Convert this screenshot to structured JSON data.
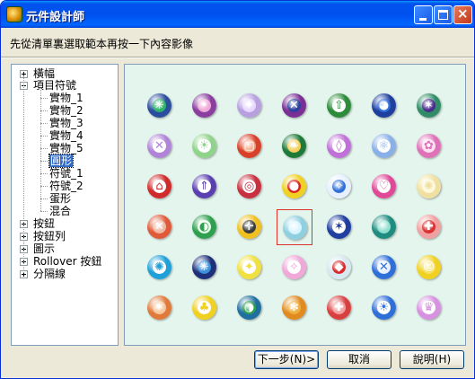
{
  "window": {
    "title": "元件設計師",
    "instruction": "先從清單裏選取範本再按一下內容影像"
  },
  "tree": {
    "items": [
      {
        "label": "橫幅",
        "expander": "plus"
      },
      {
        "label": "項目符號",
        "expander": "minus"
      },
      {
        "label": "實物_1"
      },
      {
        "label": "實物_2"
      },
      {
        "label": "實物_3"
      },
      {
        "label": "實物_4"
      },
      {
        "label": "實物_5"
      },
      {
        "label": "圓形",
        "selected": true
      },
      {
        "label": "符號_1"
      },
      {
        "label": "符號_2"
      },
      {
        "label": "蛋形"
      },
      {
        "label": "混合"
      },
      {
        "label": "按鈕",
        "expander": "plus"
      },
      {
        "label": "按鈕列",
        "expander": "plus"
      },
      {
        "label": "圖示",
        "expander": "plus"
      },
      {
        "label": "Rollover 按鈕",
        "expander": "plus"
      },
      {
        "label": "分隔線",
        "expander": "plus"
      }
    ]
  },
  "gallery": {
    "selected_index": 24,
    "items": [
      {
        "icon": "green-asterisk-bullet-icon",
        "ring": "#2b4d9e",
        "core": "#2fb36b",
        "mark": "✳"
      },
      {
        "icon": "pink-dot-bullet-icon",
        "ring": "#8a3fa0",
        "core": "#f0a8d8",
        "mark": "•"
      },
      {
        "icon": "lavender-star-bullet-icon",
        "ring": "#b8a0e0",
        "core": "#e8d8ff",
        "mark": "✦"
      },
      {
        "icon": "purple-x-bullet-icon",
        "ring": "#7a2f95",
        "core": "#2c3f9e",
        "mark": "✕"
      },
      {
        "icon": "green-arrow-up-bullet-icon",
        "ring": "#2c8c3a",
        "core": "#ffffff",
        "mark": "⇧"
      },
      {
        "icon": "blue-globe-bullet-icon",
        "ring": "#1f3f9e",
        "core": "#2f6fd8",
        "mark": "◕"
      },
      {
        "icon": "purple-star-bullet-icon",
        "ring": "#2f8c66",
        "core": "#4a2c8c",
        "mark": "✶"
      },
      {
        "icon": "purple-cross-bullet-icon",
        "ring": "#b084d8",
        "core": "#ffffff",
        "mark": "✕"
      },
      {
        "icon": "green-sun-bullet-icon",
        "ring": "#8fd48a",
        "core": "#ffffff",
        "mark": "☀"
      },
      {
        "icon": "red-square-bullet-icon",
        "ring": "#d8402a",
        "core": "#f4a080",
        "mark": "▢"
      },
      {
        "icon": "green-leaf-bullet-icon",
        "ring": "#1f7a3a",
        "core": "#f4d060",
        "mark": "❧"
      },
      {
        "icon": "purple-bulb-bullet-icon",
        "ring": "#c070d8",
        "core": "#ffffff",
        "mark": "◊"
      },
      {
        "icon": "blue-atom-bullet-icon",
        "ring": "#8ab0e8",
        "core": "#ffffff",
        "mark": "⚛"
      },
      {
        "icon": "pink-flower-bullet-icon",
        "ring": "#e070b8",
        "core": "#ffe0f0",
        "mark": "✿"
      },
      {
        "icon": "red-house-bullet-icon",
        "ring": "#d02a2a",
        "core": "#ffffff",
        "mark": "⌂"
      },
      {
        "icon": "purple-arrow-bullet-icon",
        "ring": "#5a3fb0",
        "core": "#ffffff",
        "mark": "⇑"
      },
      {
        "icon": "red-target-bullet-icon",
        "ring": "#c83040",
        "core": "#ffffff",
        "mark": "◎"
      },
      {
        "icon": "yellow-red-dot-bullet-icon",
        "ring": "#f0d020",
        "core": "#d82020",
        "mark": "●"
      },
      {
        "icon": "blue-compass-star-bullet-icon",
        "ring": "#e8f0ff",
        "core": "#2f6fd8",
        "mark": "✧"
      },
      {
        "icon": "pink-heart-bullet-icon",
        "ring": "#e04898",
        "core": "#ffffff",
        "mark": "♡"
      },
      {
        "icon": "gold-sparkle-bullet-icon",
        "ring": "#f0e0a0",
        "core": "#fff8d8",
        "mark": "✺"
      },
      {
        "icon": "orange-x-bullet-icon",
        "ring": "#e05a3a",
        "core": "#f0b8a0",
        "mark": "✕"
      },
      {
        "icon": "green-swirl-bullet-icon",
        "ring": "#2fa050",
        "core": "#e8ffe8",
        "mark": "◐"
      },
      {
        "icon": "gold-crosshair-bullet-icon",
        "ring": "#f0c020",
        "core": "#3a3a3a",
        "mark": "✛"
      },
      {
        "icon": "cyan-orb-bullet-icon",
        "ring": "#8fd0e0",
        "core": "#d8f4ff",
        "mark": ""
      },
      {
        "icon": "navy-star-bullet-icon",
        "ring": "#1f3fa0",
        "core": "#ffffff",
        "mark": "✶"
      },
      {
        "icon": "teal-sphere-bullet-icon",
        "ring": "#1f8c80",
        "core": "#8fe0d0",
        "mark": ""
      },
      {
        "icon": "red-flower-bullet-icon",
        "ring": "#f0a0a0",
        "core": "#d83030",
        "mark": "✚"
      },
      {
        "icon": "blue-gear-bullet-icon",
        "ring": "#1fa0d8",
        "core": "#ffffff",
        "mark": "✺"
      },
      {
        "icon": "navy-asterisk-bullet-icon",
        "ring": "#1f2f7a",
        "core": "#3a8fd8",
        "mark": "✳"
      },
      {
        "icon": "yellow-bulb-bullet-icon",
        "ring": "#f0e040",
        "core": "#ffffff",
        "mark": "✦"
      },
      {
        "icon": "pink-compass-bullet-icon",
        "ring": "#f0a8d8",
        "core": "#ffffff",
        "mark": "✧"
      },
      {
        "icon": "red-diamond-bullet-icon",
        "ring": "#d8e8f0",
        "core": "#d82a2a",
        "mark": "◆"
      },
      {
        "icon": "blue-x-bullet-icon",
        "ring": "#2f6fd8",
        "core": "#e8f0ff",
        "mark": "✕"
      },
      {
        "icon": "yellow-smiley-bullet-icon",
        "ring": "#f0d020",
        "core": "#f8e060",
        "mark": "☺"
      },
      {
        "icon": "orange-star-bullet-icon",
        "ring": "#e07a3a",
        "core": "#f8c8a0",
        "mark": "✶"
      },
      {
        "icon": "green-apple-bullet-icon",
        "ring": "#f0d020",
        "core": "#ffffff",
        "mark": "♣"
      },
      {
        "icon": "green-globe-bullet-icon",
        "ring": "#1f6fa0",
        "core": "#2fa050",
        "mark": "◑"
      },
      {
        "icon": "orange-person-bullet-icon",
        "ring": "#e08a20",
        "core": "#f0b040",
        "mark": "✻"
      },
      {
        "icon": "red-cross-bullet-icon",
        "ring": "#d84040",
        "core": "#f4a0a0",
        "mark": "✚"
      },
      {
        "icon": "blue-sun-bullet-icon",
        "ring": "#2f6fd8",
        "core": "#ffffff",
        "mark": "☀"
      },
      {
        "icon": "purple-crown-bullet-icon",
        "ring": "#d890e0",
        "core": "#ffffff",
        "mark": "♛"
      }
    ]
  },
  "buttons": {
    "next": "下一步(N)>",
    "cancel": "取消",
    "help": "說明(H)"
  }
}
